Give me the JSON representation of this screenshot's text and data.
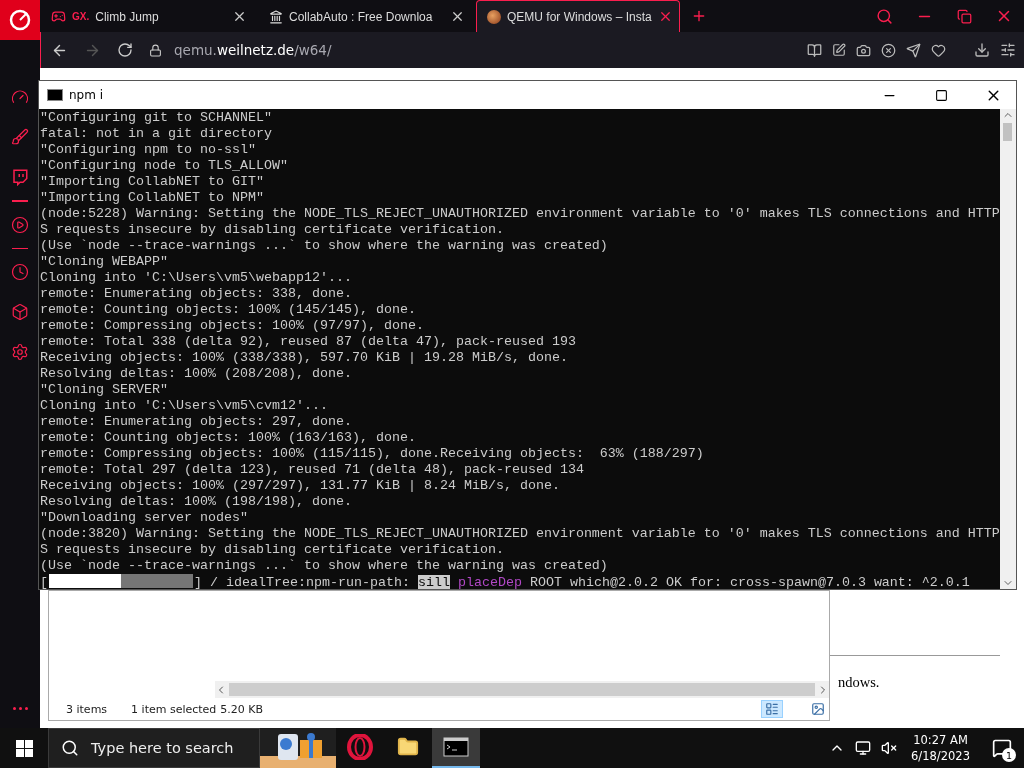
{
  "sidebar": {
    "items": [
      {
        "kind": "gauge"
      },
      {
        "kind": "broom"
      },
      {
        "kind": "twitch"
      },
      {
        "kind": "divider"
      },
      {
        "kind": "play"
      },
      {
        "kind": "divider"
      },
      {
        "kind": "clock"
      },
      {
        "kind": "cube"
      },
      {
        "kind": "gear"
      }
    ]
  },
  "tabs": [
    {
      "kind": "gx",
      "prefix": "GX.",
      "title": "Climb Jump",
      "selected": false
    },
    {
      "kind": "bank",
      "title": "CollabAuto : Free Downloa",
      "selected": false
    },
    {
      "kind": "qemu",
      "title": "QEMU for Windows – Insta",
      "selected": true
    }
  ],
  "address": {
    "url": "qemu.**weilnetz.de**/w64/"
  },
  "console": {
    "title": "npm i",
    "lines": [
      "\"Configuring git to SCHANNEL\"",
      "fatal: not in a git directory",
      "\"Configuring npm to no-ssl\"",
      "\"Configuring node to TLS_ALLOW\"",
      "\"Importing CollabNET to GIT\"",
      "\"Importing CollabNET to NPM\"",
      "(node:5228) Warning: Setting the NODE_TLS_REJECT_UNAUTHORIZED environment variable to '0' makes TLS connections and HTTP",
      "S requests insecure by disabling certificate verification.",
      "(Use `node --trace-warnings ...` to show where the warning was created)",
      "\"Cloning WEBAPP\"",
      "Cloning into 'C:\\Users\\vm5\\webapp12'...",
      "remote: Enumerating objects: 338, done.",
      "remote: Counting objects: 100% (145/145), done.",
      "remote: Compressing objects: 100% (97/97), done.",
      "remote: Total 338 (delta 92), reused 87 (delta 47), pack-reused 193",
      "Receiving objects: 100% (338/338), 597.70 KiB | 19.28 MiB/s, done.",
      "Resolving deltas: 100% (208/208), done.",
      "\"Cloning SERVER\"",
      "Cloning into 'C:\\Users\\vm5\\cvm12'...",
      "remote: Enumerating objects: 297, done.",
      "remote: Counting objects: 100% (163/163), done.",
      "remote: Compressing objects: 100% (115/115), done.Receiving objects:  63% (188/297)",
      "remote: Total 297 (delta 123), reused 71 (delta 48), pack-reused 134",
      "Receiving objects: 100% (297/297), 131.77 KiB | 8.24 MiB/s, done.",
      "Resolving deltas: 100% (198/198), done.",
      "\"Downloading server nodes\"",
      "(node:3820) Warning: Setting the NODE_TLS_REJECT_UNAUTHORIZED environment variable to '0' makes TLS connections and HTTP",
      "S requests insecure by disabling certificate verification.",
      "(Use `node --trace-warnings ...` to show where the warning was created)"
    ],
    "progress": {
      "open": "[",
      "level": 0.5,
      "close": "] / idealTree:npm-run-path:",
      "log_level": "sill",
      "topic": "placeDep",
      "message": "ROOT which@2.0.2 OK for: cross-spawn@7.0.3 want: ^2.0.1"
    }
  },
  "page": {
    "text_fragment": "ndows."
  },
  "explorer": {
    "item_count": "3 items",
    "selection": "1 item selected",
    "size": "5.20 KB"
  },
  "taskbar": {
    "search_placeholder": "Type here to search",
    "apps": [
      {
        "kind": "opera",
        "selected": false
      },
      {
        "kind": "folder",
        "selected": false
      },
      {
        "kind": "terminal",
        "selected": true
      }
    ],
    "time": "10:27 AM",
    "date": "6/18/2023",
    "notification_count": "1"
  }
}
